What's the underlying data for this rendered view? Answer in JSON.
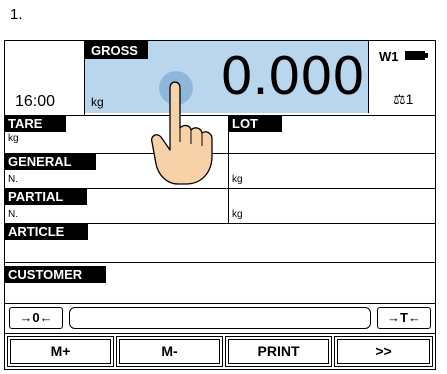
{
  "step": "1.",
  "header": {
    "time": "16:00",
    "gross_label": "GROSS",
    "unit": "kg",
    "weight": "0.000",
    "scale_id": "W1",
    "platform": "1",
    "platform_icon": "scale-icon",
    "battery_icon": "battery-icon"
  },
  "rows": {
    "tare": {
      "label": "TARE",
      "unit": "kg"
    },
    "lot": {
      "label": "LOT"
    },
    "general": {
      "label": "GENERAL",
      "count": "N.",
      "unit": "kg"
    },
    "partial": {
      "label": "PARTIAL",
      "count": "N.",
      "unit": "kg"
    },
    "article": {
      "label": "ARTICLE"
    },
    "customer": {
      "label": "CUSTOMER"
    }
  },
  "bar": {
    "zero_label": "→0←",
    "tare_label": "→T←",
    "entry_value": ""
  },
  "fkeys": [
    "M+",
    "M-",
    "PRINT",
    ">>"
  ],
  "overlay": {
    "icon": "touch-finger-icon"
  }
}
